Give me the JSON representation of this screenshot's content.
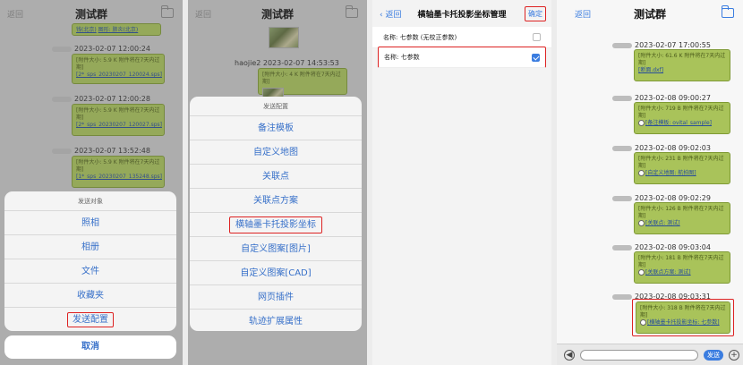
{
  "common": {
    "back": "返回",
    "title": "测试群"
  },
  "panel1": {
    "top_link": "钱(北京)",
    "top_link2": "图形: 肺炎(北京)",
    "messages": [
      {
        "time": "2023-02-07 12:00:24",
        "info": "[附件大小: 5.9 K 附件将在7天内过期]",
        "file": "[2*_sps_20230207_120024.sps]"
      },
      {
        "time": "2023-02-07 12:00:28",
        "info": "[附件大小: 5.9 K 附件将在7天内过期]",
        "file": "[2*_sps_20230207_120027.sps]"
      },
      {
        "time": "2023-02-07 13:52:48",
        "info": "[附件大小: 5.9 K 附件将在7天内过期]",
        "file": "[1*_sps_20230207_135248.sps]"
      }
    ],
    "sheet_title": "发送对象",
    "items": [
      "照相",
      "相册",
      "文件",
      "收藏夹",
      "发送配置"
    ],
    "cancel": "取消"
  },
  "panel2": {
    "sender": "haojie2 2023-02-07 14:53:53",
    "bubble_info": "[附件大小: 4 K 附件将在7天内过期]",
    "sheet_title": "发送配置",
    "items": [
      "备注模板",
      "自定义地图",
      "关联点",
      "关联点方案",
      "横轴墨卡托投影坐标",
      "自定义图案[图片]",
      "自定义图案[CAD]",
      "网页插件",
      "轨迹扩展属性"
    ]
  },
  "panel3": {
    "back": "返回",
    "title": "横轴墨卡托投影坐标管理",
    "confirm": "确定",
    "rows": [
      {
        "label": "名称: 七参数 (无校正参数)",
        "checked": false
      },
      {
        "label": "名称: 七参数",
        "checked": true
      }
    ]
  },
  "panel4": {
    "messages": [
      {
        "time": "2023-02-07 17:00:55",
        "info": "[附件大小: 61.6 K 附件将在7天内过期]",
        "file": "[断面.dxf]"
      },
      {
        "time": "2023-02-08 09:00:27",
        "info": "[附件大小: 719 B 附件将在7天内过期]",
        "file": "[备注模板: ovital_sample]"
      },
      {
        "time": "2023-02-08 09:02:03",
        "info": "[附件大小: 231 B 附件将在7天内过期]",
        "file": "[自定义地图: 航拍图]"
      },
      {
        "time": "2023-02-08 09:02:29",
        "info": "[附件大小: 126 B 附件将在7天内过期]",
        "file": "[关联点: 测试]"
      },
      {
        "time": "2023-02-08 09:03:04",
        "info": "[附件大小: 181 B 附件将在7天内过期]",
        "file": "[关联点方案: 测试]"
      },
      {
        "time": "2023-02-08 09:03:31",
        "info": "[附件大小: 318 B 附件将在7天内过期]",
        "file": "[横轴墨卡托投影坐标: 七参数]"
      }
    ],
    "send": "发送"
  }
}
